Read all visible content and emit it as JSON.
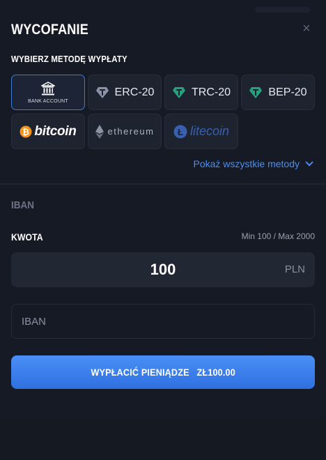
{
  "dialog": {
    "title": "WYCOFANIE",
    "close_label": "×"
  },
  "methods_section": {
    "label": "WYBIERZ METODĘ WYPŁATY",
    "show_all": "Pokaż wszystkie metody",
    "items": [
      {
        "id": "bank",
        "label": "BANK ACCOUNT",
        "icon": "bank-icon",
        "selected": true
      },
      {
        "id": "erc20",
        "label": "ERC-20",
        "icon": "tether-icon",
        "icon_color": "#8b93a8"
      },
      {
        "id": "trc20",
        "label": "TRC-20",
        "icon": "tether-icon",
        "icon_color": "#26a17b"
      },
      {
        "id": "bep20",
        "label": "BEP-20",
        "icon": "tether-icon",
        "icon_color": "#26a17b"
      },
      {
        "id": "bitcoin",
        "label": "bitcoin",
        "icon": "bitcoin-icon",
        "icon_color": "#f7931a"
      },
      {
        "id": "ethereum",
        "label": "ethereum",
        "icon": "ethereum-icon"
      },
      {
        "id": "litecoin",
        "label": "litecoin",
        "icon": "litecoin-icon",
        "icon_color": "#3a5fb0"
      }
    ]
  },
  "iban_heading": "IBAN",
  "amount": {
    "label": "KWOTA",
    "limits": "Min 100 / Max 2000",
    "value": "100",
    "currency": "PLN"
  },
  "iban_field": {
    "placeholder": "IBAN",
    "value": ""
  },
  "submit": {
    "label": "WYPŁACIĆ PIENIĄDZE",
    "amount": "ZŁ100.00"
  },
  "colors": {
    "accent": "#3d7bd9",
    "background": "#161a24",
    "tether_green": "#26a17b"
  }
}
